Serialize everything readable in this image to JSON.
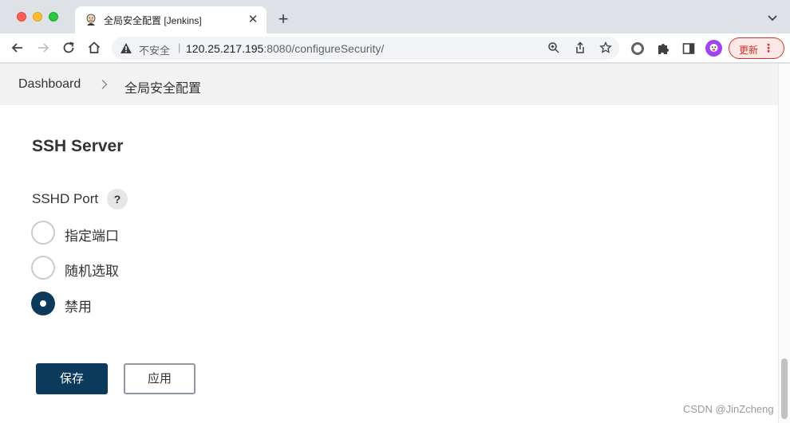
{
  "tab": {
    "title": "全局安全配置 [Jenkins]",
    "favicon": "jenkins-butler-icon"
  },
  "omnibox": {
    "security_label": "不安全",
    "separator": "|",
    "url_host": "120.25.217.195",
    "url_rest": ":8080/configureSecurity/"
  },
  "toolbar": {
    "update_label": "更新",
    "update_menu": "⋮"
  },
  "breadcrumb": {
    "items": [
      "Dashboard",
      "全局安全配置"
    ]
  },
  "section": {
    "title": "SSH Server",
    "field_label": "SSHD Port",
    "help": "?",
    "options": [
      {
        "label": "指定端口",
        "checked": false
      },
      {
        "label": "随机选取",
        "checked": false
      },
      {
        "label": "禁用",
        "checked": true
      }
    ]
  },
  "buttons": {
    "save": "保存",
    "apply": "应用"
  },
  "watermark": "CSDN @JinZcheng",
  "colors": {
    "primary": "#0b3a5d",
    "update_red": "#d93025",
    "breadcrumb_bg": "#f2f2f2"
  }
}
